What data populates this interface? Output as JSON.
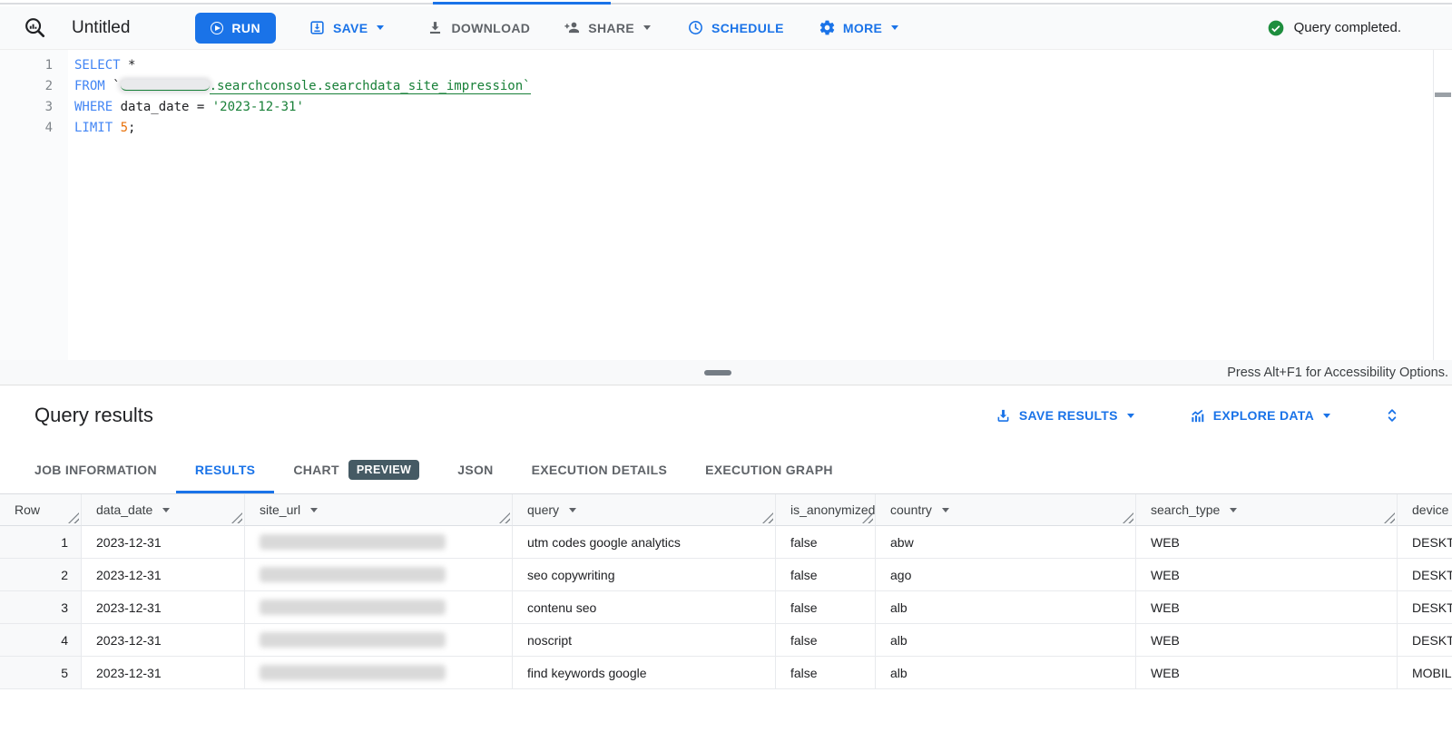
{
  "top": {
    "title": "Untitled",
    "status": "Query completed."
  },
  "toolbar": {
    "run": "RUN",
    "save": "SAVE",
    "download": "DOWNLOAD",
    "share": "SHARE",
    "schedule": "SCHEDULE",
    "more": "MORE"
  },
  "editor": {
    "accessibility_hint": "Press Alt+F1 for Accessibility Options.",
    "sql_lines": [
      {
        "num": "1",
        "parts": [
          [
            "kw",
            "SELECT"
          ],
          [
            "pl",
            " *"
          ]
        ]
      },
      {
        "num": "2",
        "parts": [
          [
            "kw",
            "FROM"
          ],
          [
            "pl",
            " `"
          ],
          [
            "redacted",
            ""
          ],
          [
            "link",
            ".searchconsole.searchdata_site_impression`"
          ]
        ]
      },
      {
        "num": "3",
        "parts": [
          [
            "kw",
            "WHERE"
          ],
          [
            "pl",
            " data_date = "
          ],
          [
            "str",
            "'2023-12-31'"
          ]
        ]
      },
      {
        "num": "4",
        "parts": [
          [
            "kw",
            "LIMIT"
          ],
          [
            "pl",
            " "
          ],
          [
            "num",
            "5"
          ],
          [
            "pl",
            ";"
          ]
        ]
      }
    ]
  },
  "results": {
    "title": "Query results",
    "save_results": "SAVE RESULTS",
    "explore_data": "EXPLORE DATA",
    "tabs": [
      {
        "label": "JOB INFORMATION",
        "active": false
      },
      {
        "label": "RESULTS",
        "active": true
      },
      {
        "label": "CHART",
        "active": false,
        "badge": "PREVIEW"
      },
      {
        "label": "JSON",
        "active": false
      },
      {
        "label": "EXECUTION DETAILS",
        "active": false
      },
      {
        "label": "EXECUTION GRAPH",
        "active": false
      }
    ],
    "table": {
      "columns": [
        {
          "key": "row",
          "label": "Row",
          "sortable": false
        },
        {
          "key": "data_date",
          "label": "data_date",
          "sortable": true
        },
        {
          "key": "site_url",
          "label": "site_url",
          "sortable": true,
          "redacted": true
        },
        {
          "key": "query",
          "label": "query",
          "sortable": true
        },
        {
          "key": "is_anonymized",
          "label": "is_anonymized",
          "sortable": true
        },
        {
          "key": "country",
          "label": "country",
          "sortable": true
        },
        {
          "key": "search_type",
          "label": "search_type",
          "sortable": true
        },
        {
          "key": "device",
          "label": "device",
          "sortable": true
        }
      ],
      "rows": [
        {
          "row": "1",
          "data_date": "2023-12-31",
          "site_url": "",
          "query": "utm codes google analytics",
          "is_anonymized": "false",
          "country": "abw",
          "search_type": "WEB",
          "device": "DESKTOP"
        },
        {
          "row": "2",
          "data_date": "2023-12-31",
          "site_url": "",
          "query": "seo copywriting",
          "is_anonymized": "false",
          "country": "ago",
          "search_type": "WEB",
          "device": "DESKTOP"
        },
        {
          "row": "3",
          "data_date": "2023-12-31",
          "site_url": "",
          "query": "contenu seo",
          "is_anonymized": "false",
          "country": "alb",
          "search_type": "WEB",
          "device": "DESKTOP"
        },
        {
          "row": "4",
          "data_date": "2023-12-31",
          "site_url": "",
          "query": "noscript",
          "is_anonymized": "false",
          "country": "alb",
          "search_type": "WEB",
          "device": "DESKTOP"
        },
        {
          "row": "5",
          "data_date": "2023-12-31",
          "site_url": "",
          "query": "find keywords google",
          "is_anonymized": "false",
          "country": "alb",
          "search_type": "WEB",
          "device": "MOBILE"
        }
      ]
    }
  },
  "icons": {
    "query_editor": "magnifier-chart-icon",
    "run": "play-circle-icon",
    "save": "save-box-arrow-icon",
    "download": "download-arrow-icon",
    "share": "person-add-icon",
    "schedule": "clock-icon",
    "more": "gear-icon",
    "status": "check-circle-icon",
    "save_results": "download-tray-icon",
    "explore_data": "insights-chart-icon",
    "collapse": "unfold-more-icon",
    "sort": "caret-down-icon",
    "resize": "column-resize-icon"
  },
  "colors": {
    "accent_blue": "#1a73e8",
    "keyword_blue": "#4285f4",
    "string_green": "#188038",
    "number_orange": "#e8710a",
    "success_green": "#1e8e3e",
    "preview_badge": "#455a64",
    "muted_gray": "#5f6368"
  }
}
